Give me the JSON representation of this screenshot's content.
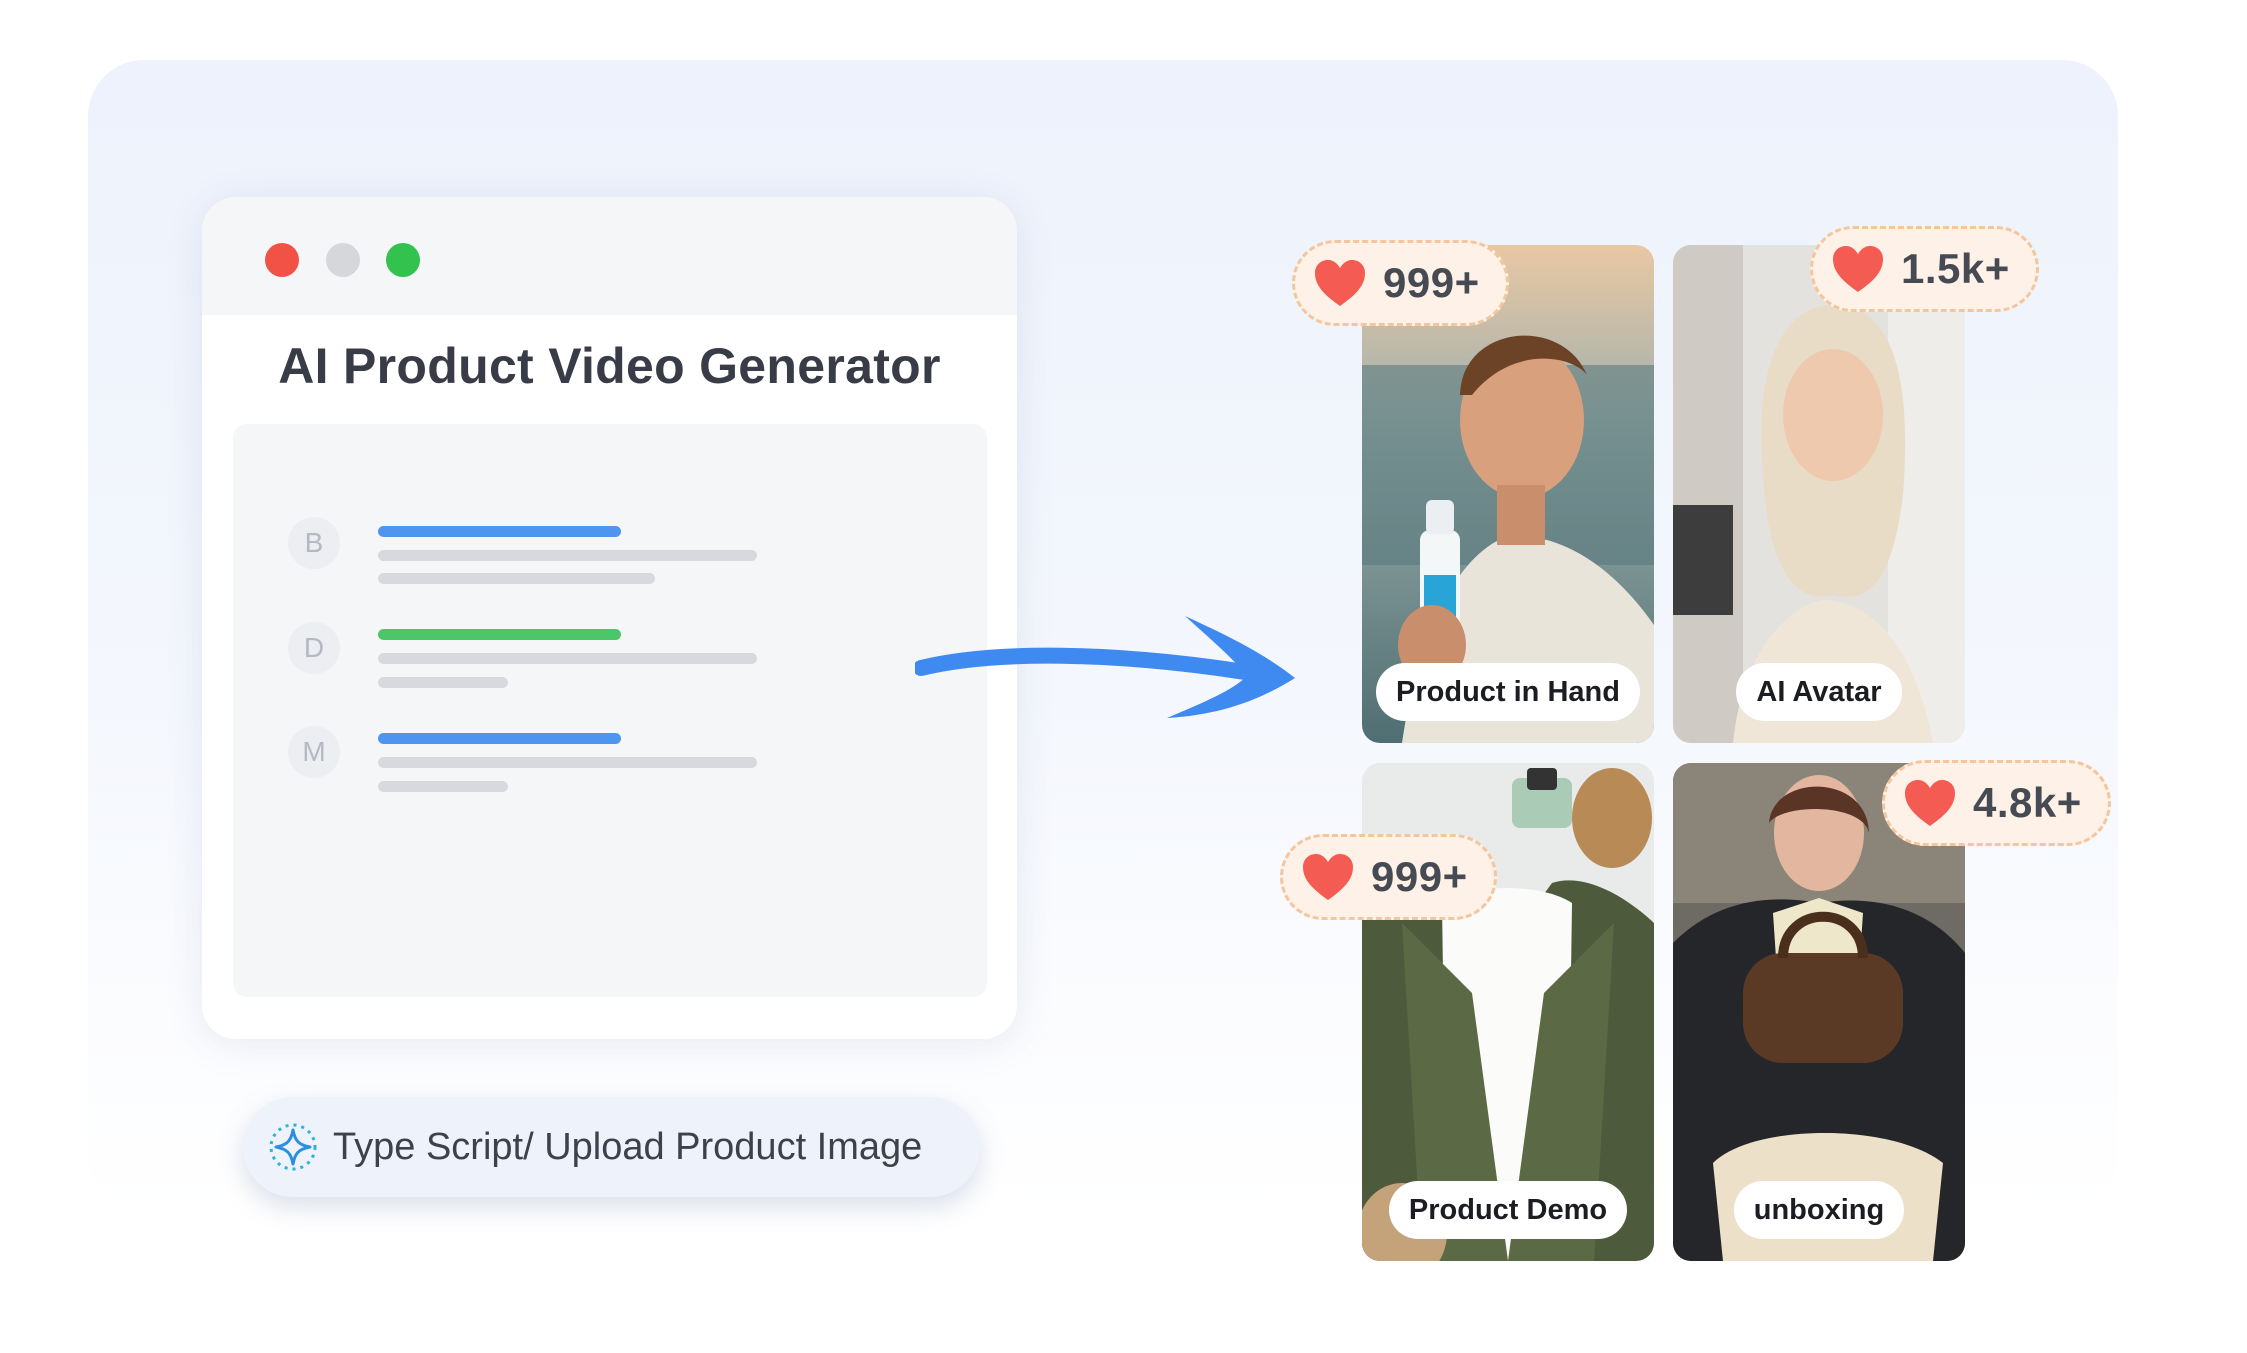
{
  "window": {
    "title": "AI Product Video Generator",
    "rows": [
      {
        "initial": "B",
        "accent": "blue"
      },
      {
        "initial": "D",
        "accent": "green"
      },
      {
        "initial": "M",
        "accent": "blue"
      }
    ]
  },
  "prompt": {
    "label": "Type Script/ Upload Product Image",
    "icon": "sparkle-icon"
  },
  "tiles": [
    {
      "label": "Product in Hand",
      "likes": "999+"
    },
    {
      "label": "AI Avatar",
      "likes": "1.5k+"
    },
    {
      "label": "Product Demo",
      "likes": "999+"
    },
    {
      "label": "unboxing",
      "likes": "4.8k+"
    }
  ],
  "colors": {
    "close": "#f25245",
    "minimize": "#d6d7da",
    "maximize": "#33c24d",
    "arrow": "#3f8af0",
    "heart": "#f45b52",
    "badge_border": "#f4c69e"
  }
}
